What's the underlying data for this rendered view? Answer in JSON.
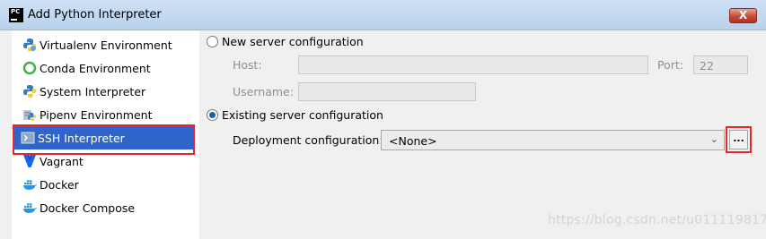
{
  "window": {
    "app_icon_text": "PC",
    "title": "Add Python Interpreter",
    "close_glyph": "X"
  },
  "sidebar": {
    "items": [
      {
        "label": "Virtualenv Environment",
        "icon": "virtualenv-icon"
      },
      {
        "label": "Conda Environment",
        "icon": "conda-icon"
      },
      {
        "label": "System Interpreter",
        "icon": "python-icon"
      },
      {
        "label": "Pipenv Environment",
        "icon": "pipenv-icon"
      },
      {
        "label": "SSH Interpreter",
        "icon": "ssh-icon",
        "selected": true
      },
      {
        "label": "Vagrant",
        "icon": "vagrant-icon"
      },
      {
        "label": "Docker",
        "icon": "docker-icon"
      },
      {
        "label": "Docker Compose",
        "icon": "docker-compose-icon"
      }
    ]
  },
  "new_server": {
    "radio_label": "New server configuration",
    "host_label": "Host:",
    "host_value": "",
    "port_label": "Port:",
    "port_value": "22",
    "username_label": "Username:",
    "username_value": ""
  },
  "existing_server": {
    "radio_label": "Existing server configuration",
    "deployment_label": "Deployment configuration:",
    "deployment_value": "<None>",
    "browse_label": "..."
  },
  "watermark": "https://blog.csdn.net/u011119817",
  "colors": {
    "selection": "#2f65ca",
    "annotation_red": "#e8242c",
    "python_blue": "#3a78b6",
    "python_yellow": "#f2cf3d",
    "conda_green": "#43b049",
    "vagrant_blue": "#1563ff",
    "docker_blue": "#2496ed"
  }
}
